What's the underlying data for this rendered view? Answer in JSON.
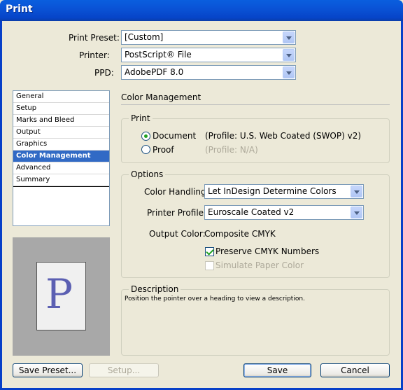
{
  "window": {
    "title": "Print"
  },
  "fields": {
    "print_preset": {
      "label": "Print Preset:",
      "value": "[Custom]"
    },
    "printer": {
      "label": "Printer:",
      "value": "PostScript® File"
    },
    "ppd": {
      "label": "PPD:",
      "value": "AdobePDF 8.0"
    }
  },
  "sidebar": {
    "items": [
      {
        "label": "General"
      },
      {
        "label": "Setup"
      },
      {
        "label": "Marks and Bleed"
      },
      {
        "label": "Output"
      },
      {
        "label": "Graphics"
      },
      {
        "label": "Color Management"
      },
      {
        "label": "Advanced"
      },
      {
        "label": "Summary"
      }
    ],
    "selected_index": 5
  },
  "preview": {
    "letter": "P"
  },
  "panel": {
    "heading": "Color Management",
    "print_group": {
      "title": "Print",
      "document": {
        "label": "Document",
        "profile": "(Profile: U.S. Web Coated (SWOP) v2)",
        "selected": true
      },
      "proof": {
        "label": "Proof",
        "profile": "(Profile: N/A)",
        "selected": false
      }
    },
    "options_group": {
      "title": "Options",
      "color_handling": {
        "label": "Color Handling:",
        "value": "Let InDesign Determine Colors"
      },
      "printer_profile": {
        "label": "Printer Profile:",
        "value": "Euroscale Coated v2"
      },
      "output_color": {
        "label": "Output Color:",
        "value": "Composite CMYK"
      },
      "preserve_cmyk": {
        "label": "Preserve CMYK Numbers",
        "checked": true
      },
      "simulate_paper": {
        "label": "Simulate Paper Color",
        "checked": false,
        "disabled": true
      }
    },
    "description_group": {
      "title": "Description",
      "text": "Position the pointer over a heading to view a description."
    }
  },
  "buttons": {
    "save_preset": "Save Preset...",
    "setup": "Setup...",
    "save": "Save",
    "cancel": "Cancel"
  }
}
